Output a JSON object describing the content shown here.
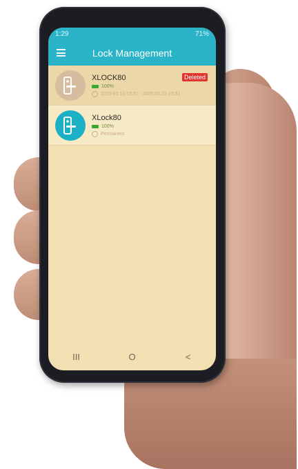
{
  "status": {
    "time": "1:29",
    "battery": "71%"
  },
  "app": {
    "title": "Lock Management"
  },
  "locks": [
    {
      "name": "XLOCK80",
      "battery": "100%",
      "validity": "2019.03.13 13:31 - 2020.03.13 13:31",
      "badge": "Deleted"
    },
    {
      "name": "XLock80",
      "battery": "100%",
      "validity": "Permanent"
    }
  ],
  "navbar": {
    "recent": "III",
    "home": "O",
    "back": "<"
  },
  "colors": {
    "accent": "#2bb3c7",
    "background": "#f2e0b3",
    "deleted_badge": "#e0332e",
    "battery": "#39a832"
  },
  "icons": [
    "menu-icon",
    "lock-icon",
    "battery-icon",
    "clock-icon"
  ]
}
